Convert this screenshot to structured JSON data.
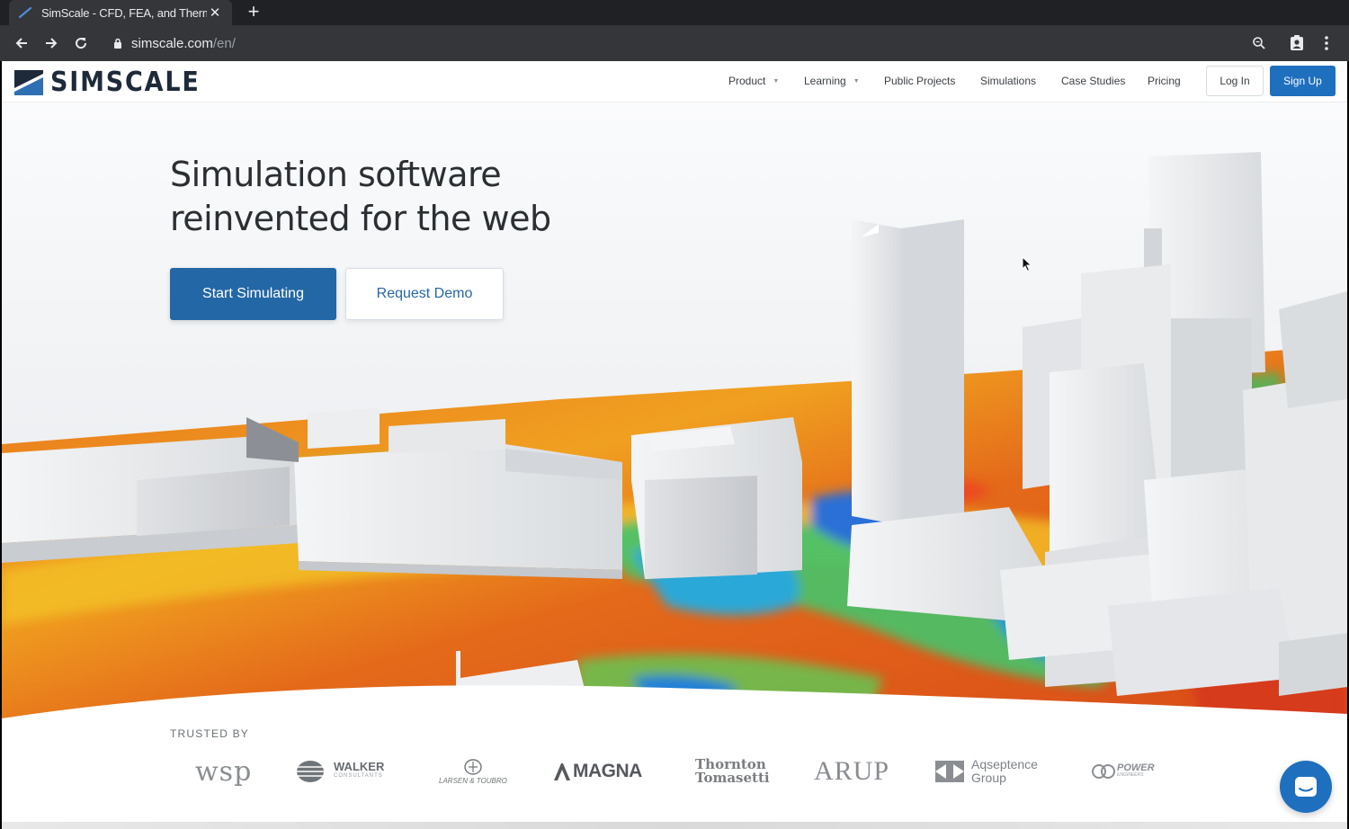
{
  "browser": {
    "tab_title": "SimScale - CFD, FEA, and Therm",
    "url_domain": "simscale.com",
    "url_path": "/en/"
  },
  "header": {
    "logo_text": "SIMSCALE",
    "nav": {
      "product": "Product",
      "learning": "Learning",
      "public_projects": "Public Projects",
      "simulations": "Simulations",
      "case_studies": "Case Studies",
      "pricing": "Pricing"
    },
    "login": "Log In",
    "signup": "Sign Up"
  },
  "hero": {
    "title_line1": "Simulation software",
    "title_line2": "reinvented for the web",
    "cta_primary": "Start Simulating",
    "cta_secondary": "Request Demo"
  },
  "trusted": {
    "label": "TRUSTED BY",
    "logos": {
      "wsp": "wsp",
      "walker": "WALKER",
      "walker_sub": "CONSULTANTS",
      "lt": "LARSEN & TOUBRO",
      "magna": "MAGNA",
      "thornton_1": "Thornton",
      "thornton_2": "Tomasetti",
      "arup": "ARUP",
      "aqseptence_1": "Aqseptence",
      "aqseptence_2": "Group",
      "power": "POWER",
      "power_sub": "ENGINEERS"
    }
  },
  "colors": {
    "brand_blue": "#1f6fbf",
    "cta_blue": "#2467a6",
    "chrome_dark": "#202124",
    "chrome_toolbar": "#35363a"
  }
}
